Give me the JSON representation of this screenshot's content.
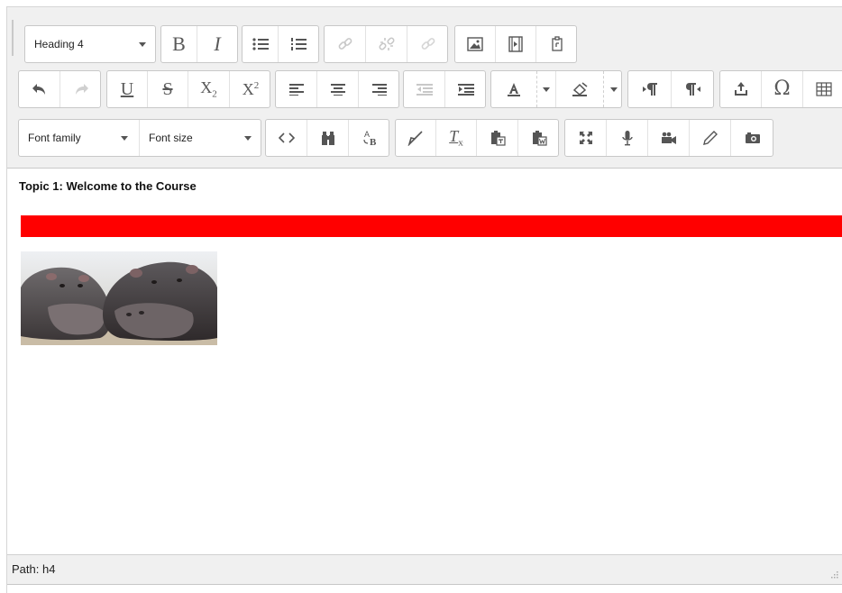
{
  "toolbar": {
    "format_select": "Heading 4",
    "font_family": "Font family",
    "font_size": "Font size",
    "bold": "B",
    "italic": "I",
    "underline": "U",
    "strike": "S",
    "subscript": "X",
    "subscript_small": "2",
    "superscript": "X",
    "superscript_small": "2",
    "omega": "Ω",
    "clear_format": "T",
    "clear_format_small": "x"
  },
  "content": {
    "heading": "Topic 1: Welcome to the Course",
    "bar_color": "#ff0000",
    "image_alt": "hippos"
  },
  "status": {
    "path": "Path: h4"
  }
}
